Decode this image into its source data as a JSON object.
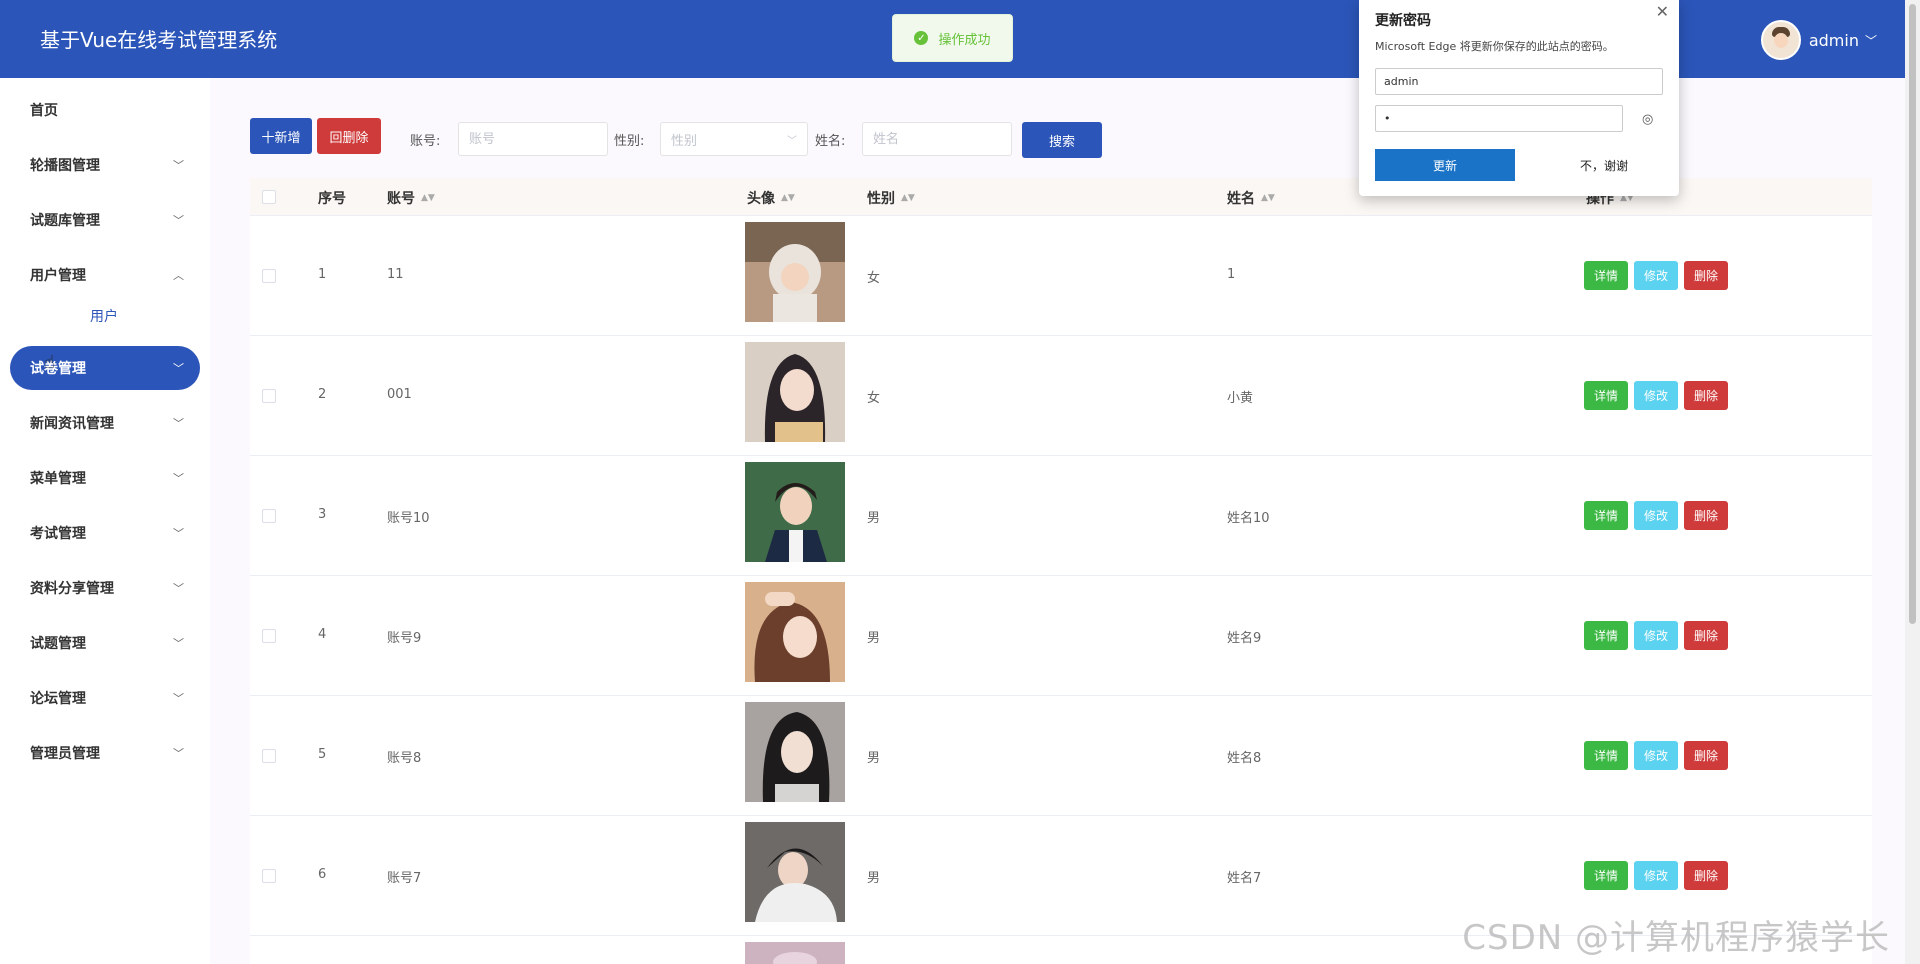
{
  "header": {
    "title": "基于Vue在线考试管理系统",
    "user": "admin",
    "caret": "﹀"
  },
  "toast": {
    "text": "操作成功",
    "icon": "✓"
  },
  "sidebar": {
    "items": [
      {
        "label": "首页",
        "chev": ""
      },
      {
        "label": "轮播图管理",
        "chev": "﹀"
      },
      {
        "label": "试题库管理",
        "chev": "﹀"
      },
      {
        "label": "用户管理",
        "chev": "︿"
      },
      {
        "label": "试卷管理",
        "chev": "﹀"
      },
      {
        "label": "新闻资讯管理",
        "chev": "﹀"
      },
      {
        "label": "菜单管理",
        "chev": "﹀"
      },
      {
        "label": "考试管理",
        "chev": "﹀"
      },
      {
        "label": "资料分享管理",
        "chev": "﹀"
      },
      {
        "label": "试题管理",
        "chev": "﹀"
      },
      {
        "label": "论坛管理",
        "chev": "﹀"
      },
      {
        "label": "管理员管理",
        "chev": "﹀"
      }
    ],
    "subitem": "用户"
  },
  "toolbar": {
    "add_label": "十新增",
    "delete_label": "回删除",
    "account_label": "账号:",
    "account_placeholder": "账号",
    "gender_label": "性别:",
    "gender_placeholder": "性别",
    "name_label": "姓名:",
    "name_placeholder": "姓名",
    "search_label": "搜索"
  },
  "table": {
    "columns": {
      "index": "序号",
      "account": "账号",
      "avatar": "头像",
      "gender": "性别",
      "name": "姓名",
      "ops": "操作"
    },
    "rows": [
      {
        "index": "1",
        "account": "11",
        "gender": "女",
        "name": "1"
      },
      {
        "index": "2",
        "account": "001",
        "gender": "女",
        "name": "小黄"
      },
      {
        "index": "3",
        "account": "账号10",
        "gender": "男",
        "name": "姓名10"
      },
      {
        "index": "4",
        "account": "账号9",
        "gender": "男",
        "name": "姓名9"
      },
      {
        "index": "5",
        "account": "账号8",
        "gender": "男",
        "name": "姓名8"
      },
      {
        "index": "6",
        "account": "账号7",
        "gender": "男",
        "name": "姓名7"
      }
    ],
    "op_labels": {
      "detail": "详情",
      "edit": "修改",
      "delete": "删除"
    },
    "sort_icon": "▲▼"
  },
  "popup": {
    "title": "更新密码",
    "description": "Microsoft Edge 将更新你保存的此站点的密码。",
    "username": "admin",
    "password": "•",
    "update_label": "更新",
    "decline_label": "不，谢谢",
    "close_icon": "✕",
    "eye_icon": "◎"
  },
  "watermark": "CSDN @计算机程序猿学长"
}
